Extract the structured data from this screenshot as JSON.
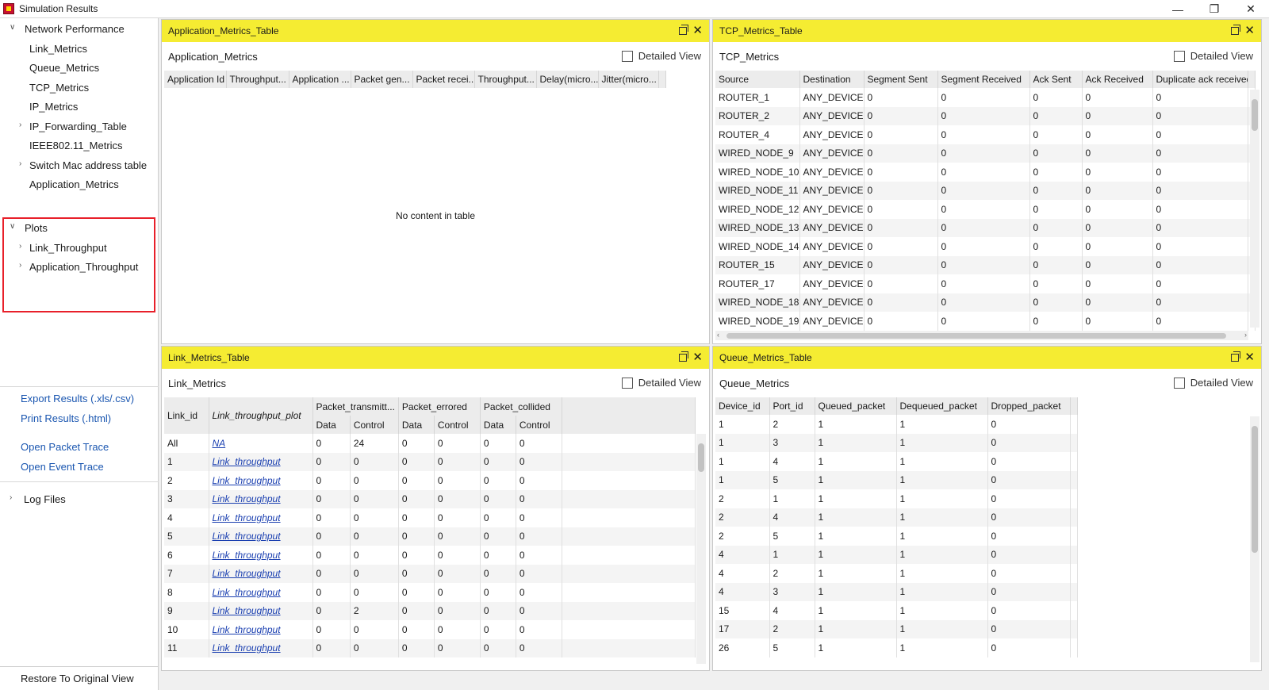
{
  "window": {
    "title": "Simulation Results",
    "minimize": "—",
    "maximize": "❐",
    "close": "✕"
  },
  "sidebar": {
    "network_performance": "Network Performance",
    "items": [
      "Link_Metrics",
      "Queue_Metrics",
      "TCP_Metrics",
      "IP_Metrics",
      "IP_Forwarding_Table",
      "IEEE802.11_Metrics",
      "Switch Mac address table",
      "Application_Metrics"
    ],
    "plots": "Plots",
    "plot_items": [
      "Link_Throughput",
      "Application_Throughput"
    ],
    "export": "Export Results (.xls/.csv)",
    "print": "Print Results (.html)",
    "packet_trace": "Open Packet Trace",
    "event_trace": "Open Event Trace",
    "log_files": "Log Files",
    "restore": "Restore To Original View",
    "highlight_color": "#e8202a"
  },
  "panels": {
    "application": {
      "tab_title": "Application_Metrics_Table",
      "title": "Application_Metrics",
      "detailed_view": "Detailed View",
      "columns": [
        "Application Id",
        "Throughput...",
        "Application ...",
        "Packet gen...",
        "Packet recei...",
        "Throughput...",
        "Delay(micro...",
        "Jitter(micro..."
      ],
      "empty": "No content in table"
    },
    "tcp": {
      "tab_title": "TCP_Metrics_Table",
      "title": "TCP_Metrics",
      "detailed_view": "Detailed View",
      "columns": [
        "Source",
        "Destination",
        "Segment Sent",
        "Segment Received",
        "Ack Sent",
        "Ack Received",
        "Duplicate ack received"
      ],
      "rows": [
        [
          "ROUTER_1",
          "ANY_DEVICE",
          "0",
          "0",
          "0",
          "0",
          "0"
        ],
        [
          "ROUTER_2",
          "ANY_DEVICE",
          "0",
          "0",
          "0",
          "0",
          "0"
        ],
        [
          "ROUTER_4",
          "ANY_DEVICE",
          "0",
          "0",
          "0",
          "0",
          "0"
        ],
        [
          "WIRED_NODE_9",
          "ANY_DEVICE",
          "0",
          "0",
          "0",
          "0",
          "0"
        ],
        [
          "WIRED_NODE_10",
          "ANY_DEVICE",
          "0",
          "0",
          "0",
          "0",
          "0"
        ],
        [
          "WIRED_NODE_11",
          "ANY_DEVICE",
          "0",
          "0",
          "0",
          "0",
          "0"
        ],
        [
          "WIRED_NODE_12",
          "ANY_DEVICE",
          "0",
          "0",
          "0",
          "0",
          "0"
        ],
        [
          "WIRED_NODE_13",
          "ANY_DEVICE",
          "0",
          "0",
          "0",
          "0",
          "0"
        ],
        [
          "WIRED_NODE_14",
          "ANY_DEVICE",
          "0",
          "0",
          "0",
          "0",
          "0"
        ],
        [
          "ROUTER_15",
          "ANY_DEVICE",
          "0",
          "0",
          "0",
          "0",
          "0"
        ],
        [
          "ROUTER_17",
          "ANY_DEVICE",
          "0",
          "0",
          "0",
          "0",
          "0"
        ],
        [
          "WIRED_NODE_18",
          "ANY_DEVICE",
          "0",
          "0",
          "0",
          "0",
          "0"
        ],
        [
          "WIRED_NODE_19",
          "ANY_DEVICE",
          "0",
          "0",
          "0",
          "0",
          "0"
        ]
      ]
    },
    "link": {
      "tab_title": "Link_Metrics_Table",
      "title": "Link_Metrics",
      "detailed_view": "Detailed View",
      "col_link_id": "Link_id",
      "col_plot": "Link_throughput_plot",
      "groups": [
        "Packet_transmitt...",
        "Packet_errored",
        "Packet_collided"
      ],
      "sub": [
        "Data",
        "Control"
      ],
      "rows": [
        [
          "All",
          "NA",
          "0",
          "24",
          "0",
          "0",
          "0",
          "0"
        ],
        [
          "1",
          "Link_throughput",
          "0",
          "0",
          "0",
          "0",
          "0",
          "0"
        ],
        [
          "2",
          "Link_throughput",
          "0",
          "0",
          "0",
          "0",
          "0",
          "0"
        ],
        [
          "3",
          "Link_throughput",
          "0",
          "0",
          "0",
          "0",
          "0",
          "0"
        ],
        [
          "4",
          "Link_throughput",
          "0",
          "0",
          "0",
          "0",
          "0",
          "0"
        ],
        [
          "5",
          "Link_throughput",
          "0",
          "0",
          "0",
          "0",
          "0",
          "0"
        ],
        [
          "6",
          "Link_throughput",
          "0",
          "0",
          "0",
          "0",
          "0",
          "0"
        ],
        [
          "7",
          "Link_throughput",
          "0",
          "0",
          "0",
          "0",
          "0",
          "0"
        ],
        [
          "8",
          "Link_throughput",
          "0",
          "0",
          "0",
          "0",
          "0",
          "0"
        ],
        [
          "9",
          "Link_throughput",
          "0",
          "2",
          "0",
          "0",
          "0",
          "0"
        ],
        [
          "10",
          "Link_throughput",
          "0",
          "0",
          "0",
          "0",
          "0",
          "0"
        ],
        [
          "11",
          "Link_throughput",
          "0",
          "0",
          "0",
          "0",
          "0",
          "0"
        ]
      ]
    },
    "queue": {
      "tab_title": "Queue_Metrics_Table",
      "title": "Queue_Metrics",
      "detailed_view": "Detailed View",
      "columns": [
        "Device_id",
        "Port_id",
        "Queued_packet",
        "Dequeued_packet",
        "Dropped_packet"
      ],
      "rows": [
        [
          "1",
          "2",
          "1",
          "1",
          "0"
        ],
        [
          "1",
          "3",
          "1",
          "1",
          "0"
        ],
        [
          "1",
          "4",
          "1",
          "1",
          "0"
        ],
        [
          "1",
          "5",
          "1",
          "1",
          "0"
        ],
        [
          "2",
          "1",
          "1",
          "1",
          "0"
        ],
        [
          "2",
          "4",
          "1",
          "1",
          "0"
        ],
        [
          "2",
          "5",
          "1",
          "1",
          "0"
        ],
        [
          "4",
          "1",
          "1",
          "1",
          "0"
        ],
        [
          "4",
          "2",
          "1",
          "1",
          "0"
        ],
        [
          "4",
          "3",
          "1",
          "1",
          "0"
        ],
        [
          "15",
          "4",
          "1",
          "1",
          "0"
        ],
        [
          "17",
          "2",
          "1",
          "1",
          "0"
        ],
        [
          "26",
          "5",
          "1",
          "1",
          "0"
        ]
      ]
    }
  },
  "header_color": "#f5ec32"
}
